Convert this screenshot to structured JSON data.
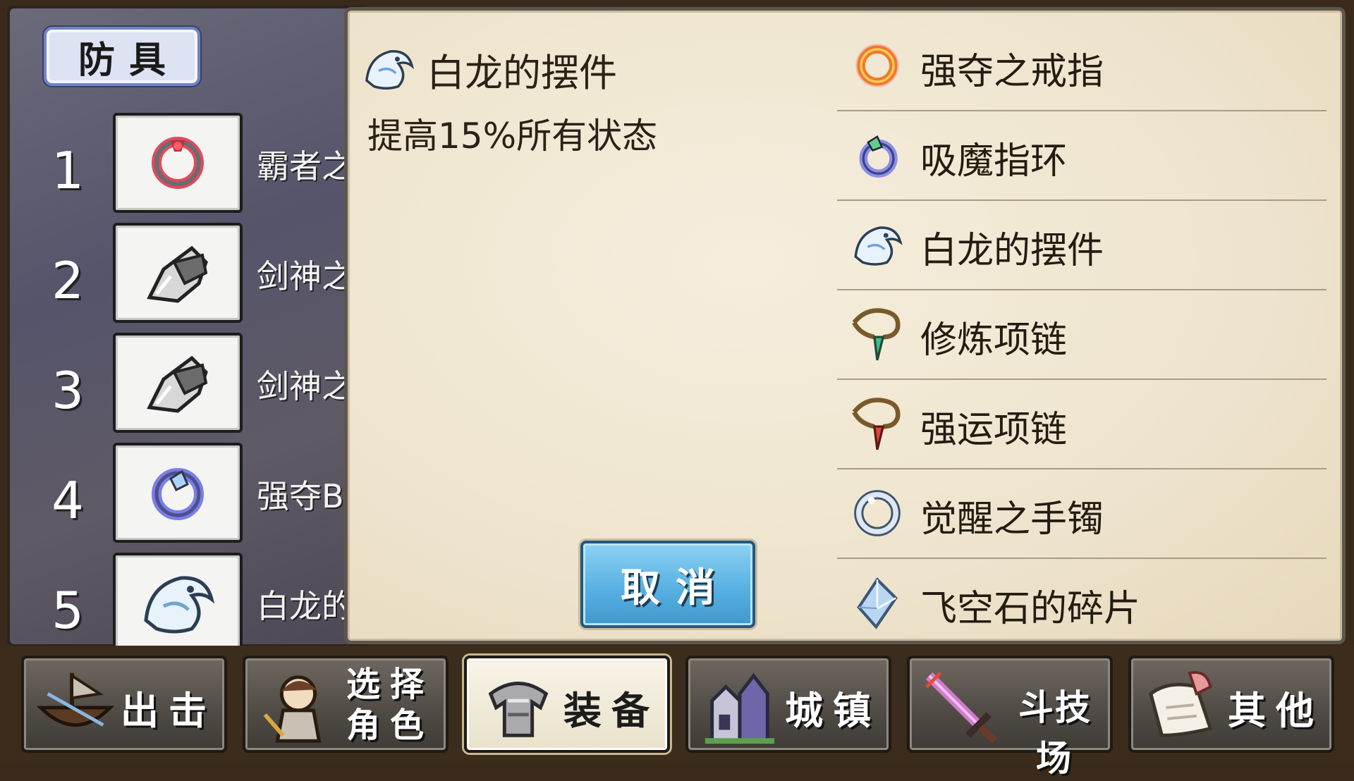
{
  "armor_panel": {
    "title": "防具",
    "slots": [
      {
        "number": "1",
        "name": "霸者之",
        "icon": "red-dragon-ring-icon"
      },
      {
        "number": "2",
        "name": "剑神之",
        "icon": "silver-gauntlet-icon"
      },
      {
        "number": "3",
        "name": "剑神之",
        "icon": "silver-gauntlet-icon"
      },
      {
        "number": "4",
        "name": "强夺Bl",
        "icon": "blue-ring-icon"
      },
      {
        "number": "5",
        "name": "白龙的",
        "icon": "white-dragon-ornament-icon"
      }
    ]
  },
  "detail": {
    "name": "白龙的摆件",
    "description": "提高15%所有状态",
    "icon": "white-dragon-ornament-icon"
  },
  "cancel_button": {
    "label": "取消"
  },
  "item_list": [
    {
      "label": "强夺之戒指",
      "icon": "orange-ring-icon"
    },
    {
      "label": "吸魔指环",
      "icon": "blue-green-ring-icon"
    },
    {
      "label": "白龙的摆件",
      "icon": "white-dragon-ornament-icon"
    },
    {
      "label": "修炼项链",
      "icon": "green-pendant-necklace-icon"
    },
    {
      "label": "强运项链",
      "icon": "red-pendant-necklace-icon"
    },
    {
      "label": "觉醒之手镯",
      "icon": "silver-bracelet-icon"
    },
    {
      "label": "飞空石的碎片",
      "icon": "crystal-shard-icon"
    }
  ],
  "tabs": [
    {
      "label": "出击",
      "icon": "ship-icon",
      "active": false
    },
    {
      "label": "选择角色",
      "line1": "选择",
      "line2": "角色",
      "icon": "character-icon",
      "active": false
    },
    {
      "label": "装备",
      "icon": "armor-icon",
      "active": true
    },
    {
      "label": "城镇",
      "icon": "castle-icon",
      "active": false
    },
    {
      "label": "斗技场",
      "icon": "sword-icon",
      "active": false
    },
    {
      "label": "其他",
      "icon": "scroll-icon",
      "active": false
    }
  ],
  "colors": {
    "parchment": "#efe5cf",
    "cancel_button": "#58b1e2",
    "active_tab": "#f7f3e6"
  }
}
